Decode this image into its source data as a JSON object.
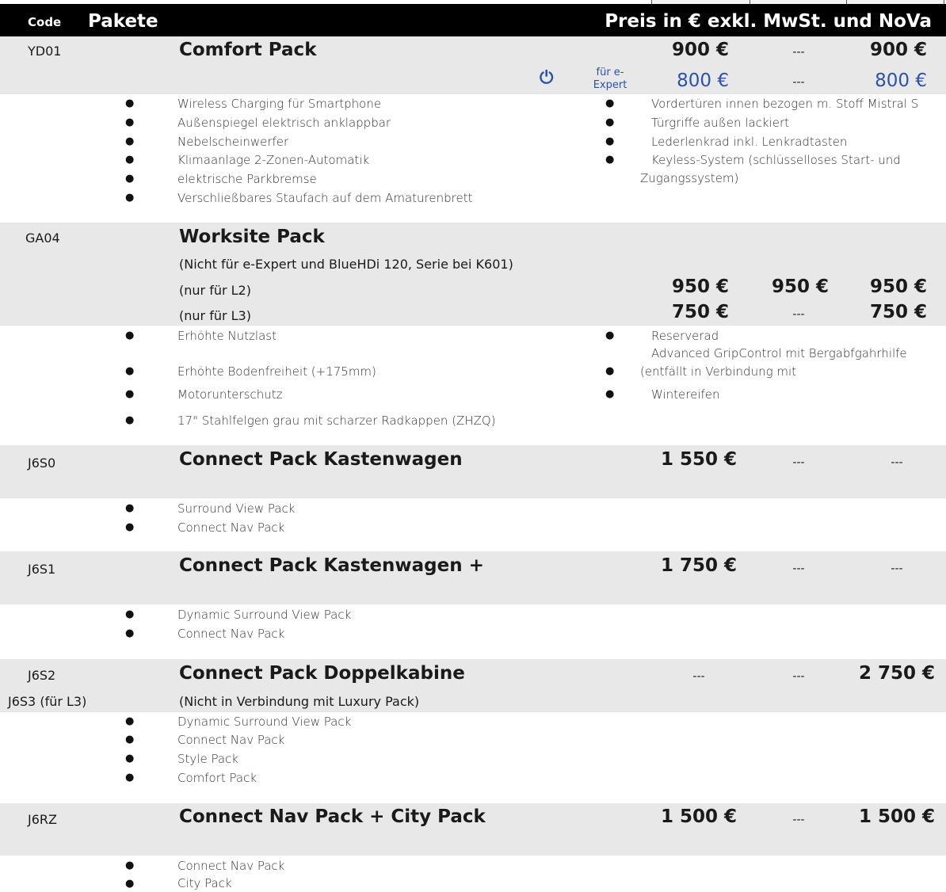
{
  "header": {
    "code": "Code",
    "pakete": "Pakete",
    "preis": "Preis in € exkl. MwSt. und NoVa"
  },
  "dash": "---",
  "pkg1": {
    "code": "YD01",
    "title": "Comfort Pack",
    "price1": "900 €",
    "price3": "900 €",
    "e_note": "für e-Expert",
    "e_price1": "800 €",
    "e_price3": "800 €",
    "icon": "power-icon",
    "features_left": [
      "Wireless Charging für Smartphone",
      "Außenspiegel elektrisch anklappbar",
      "Nebelscheinwerfer",
      "Klimaanlage 2-Zonen-Automatik",
      "elektrische Parkbremse",
      "Verschließbares Staufach auf dem Amaturenbrett"
    ],
    "features_right": [
      "Vordertüren innen bezogen m. Stoff Mistral S",
      "Türgriffe außen lackiert",
      "Lederlenkrad inkl. Lenkradtasten",
      "Keyless-System (schlüsselloses Start- und",
      "Zugangssystem)"
    ]
  },
  "pkg2": {
    "code": "GA04",
    "title": "Worksite Pack",
    "note": "(Nicht für e-Expert und BlueHDi 120, Serie bei K601)",
    "l2": "(nur für L2)",
    "l3": "(nur für L3)",
    "l2_price1": "950 €",
    "l2_price2": "950 €",
    "l2_price3": "950 €",
    "l3_price1": "750 €",
    "l3_price3": "750 €",
    "features_left": [
      "Erhöhte Nutzlast",
      "Erhöhte Bodenfreiheit (+175mm)",
      "Motorunterschutz",
      "17\" Stahlfelgen grau mit scharzer Radkappen (ZHZQ)"
    ],
    "features_right": [
      "Reserverad",
      "Advanced GripControl mit Bergabfgahrhilfe",
      "(entfällt in Verbindung mit",
      "Wintereifen"
    ]
  },
  "pkg3": {
    "code": "J6S0",
    "title": "Connect Pack Kastenwagen",
    "price1": "1 550 €",
    "features": [
      "Surround View Pack",
      "Connect Nav Pack"
    ]
  },
  "pkg4": {
    "code": "J6S1",
    "title": "Connect Pack Kastenwagen +",
    "price1": "1 750 €",
    "features": [
      "Dynamic Surround View Pack",
      "Connect Nav Pack"
    ]
  },
  "pkg5": {
    "code": "J6S2",
    "code2": "J6S3 (für L3)",
    "title": "Connect Pack Doppelkabine",
    "note": "(Nicht in Verbindung mit Luxury Pack)",
    "price3": "2 750 €",
    "features": [
      "Dynamic Surround View Pack",
      "Connect Nav Pack",
      "Style Pack",
      "Comfort Pack"
    ]
  },
  "pkg6": {
    "code": "J6RZ",
    "title": "Connect Nav Pack + City Pack",
    "price1": "1 500 €",
    "price3": "1 500 €",
    "features": [
      "Connect Nav Pack",
      "City Pack"
    ]
  }
}
